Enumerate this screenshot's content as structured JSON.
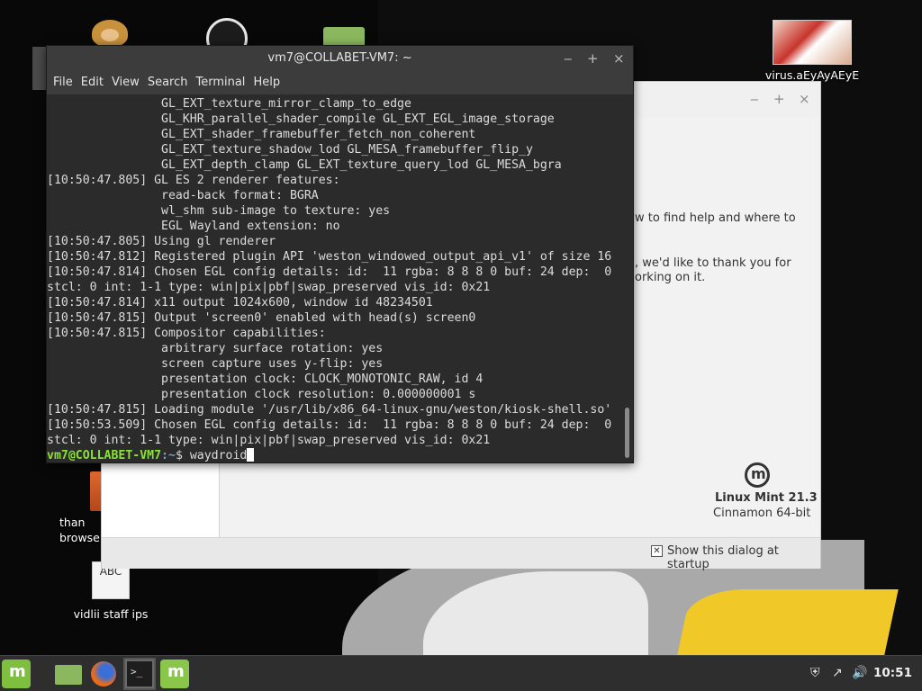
{
  "desktop": {
    "icons": [
      {
        "id": "monkey",
        "label": ""
      },
      {
        "id": "obs",
        "label": ""
      },
      {
        "id": "folder",
        "label": ""
      },
      {
        "id": "virus",
        "label": "virus.aEyAyAEyE"
      },
      {
        "id": "thank",
        "label_lines": [
          "than",
          "browse"
        ]
      },
      {
        "id": "vidlii",
        "label": "vidlii staff ips",
        "thumb_text": "ABC"
      }
    ]
  },
  "welcome": {
    "text_1": "w to find help and where to",
    "text_2": ", we'd like to thank you for",
    "text_3": "orking on it.",
    "version": "Linux Mint 21.3",
    "edition": "Cinnamon 64-bit",
    "startup_label": "Show this dialog at startup",
    "startup_checked": true,
    "buttons": {
      "minimize": "‒",
      "maximize": "+",
      "close": "×"
    }
  },
  "terminal": {
    "title": "vm7@COLLABET-VM7: ~",
    "buttons": {
      "minimize": "‒",
      "maximize": "+",
      "close": "×"
    },
    "menu": [
      "File",
      "Edit",
      "View",
      "Search",
      "Terminal",
      "Help"
    ],
    "lines": [
      "                GL_EXT_texture_mirror_clamp_to_edge",
      "                GL_KHR_parallel_shader_compile GL_EXT_EGL_image_storage",
      "                GL_EXT_shader_framebuffer_fetch_non_coherent",
      "                GL_EXT_texture_shadow_lod GL_MESA_framebuffer_flip_y",
      "                GL_EXT_depth_clamp GL_EXT_texture_query_lod GL_MESA_bgra",
      "[10:50:47.805] GL ES 2 renderer features:",
      "                read-back format: BGRA",
      "                wl_shm sub-image to texture: yes",
      "                EGL Wayland extension: no",
      "[10:50:47.805] Using gl renderer",
      "[10:50:47.812] Registered plugin API 'weston_windowed_output_api_v1' of size 16",
      "[10:50:47.814] Chosen EGL config details: id:  11 rgba: 8 8 8 0 buf: 24 dep:  0",
      "stcl: 0 int: 1-1 type: win|pix|pbf|swap_preserved vis_id: 0x21",
      "[10:50:47.814] x11 output 1024x600, window id 48234501",
      "[10:50:47.815] Output 'screen0' enabled with head(s) screen0",
      "[10:50:47.815] Compositor capabilities:",
      "                arbitrary surface rotation: yes",
      "                screen capture uses y-flip: yes",
      "                presentation clock: CLOCK_MONOTONIC_RAW, id 4",
      "                presentation clock resolution: 0.000000001 s",
      "[10:50:47.815] Loading module '/usr/lib/x86_64-linux-gnu/weston/kiosk-shell.so'",
      "[10:50:53.509] Chosen EGL config details: id:  11 rgba: 8 8 8 0 buf: 24 dep:  0",
      "stcl: 0 int: 1-1 type: win|pix|pbf|swap_preserved vis_id: 0x21"
    ],
    "prompt_user": "vm7@COLLABET-VM7",
    "prompt_path": ":~",
    "prompt_symbol": "$ ",
    "command": "waydroid"
  },
  "taskbar": {
    "items": [
      "mint-menu",
      "files",
      "firefox",
      "terminal",
      "welcome-screen"
    ],
    "clock": "10:51",
    "tray": [
      "shield-icon",
      "network-icon",
      "volume-icon"
    ]
  },
  "colors": {
    "prompt_user": "#8ae234",
    "prompt_path": "#729fcf",
    "mint_green": "#8ac64a"
  }
}
